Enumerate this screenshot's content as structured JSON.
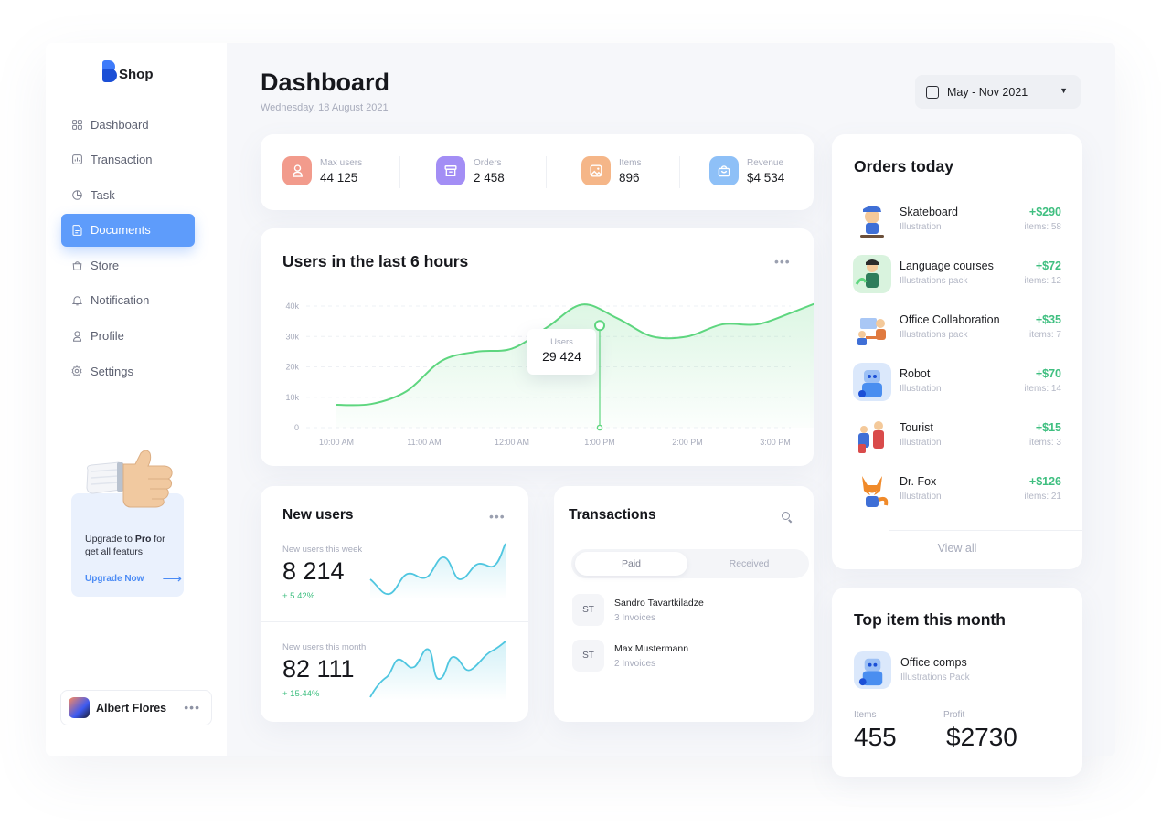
{
  "brand": {
    "name": "Shop",
    "colors": {
      "primary": "#5e9cfb",
      "positive": "#3fbf80",
      "chart_line": "#5ed67f",
      "sparkline": "#4fc6e0"
    }
  },
  "sidebar": {
    "items": [
      {
        "label": "Dashboard",
        "icon": "grid-icon",
        "active": false
      },
      {
        "label": "Transaction",
        "icon": "chart-icon",
        "active": false
      },
      {
        "label": "Task",
        "icon": "pie-icon",
        "active": false
      },
      {
        "label": "Documents",
        "icon": "document-icon",
        "active": true
      },
      {
        "label": "Store",
        "icon": "bag-icon",
        "active": false
      },
      {
        "label": "Notification",
        "icon": "bell-icon",
        "active": false
      },
      {
        "label": "Profile",
        "icon": "user-icon",
        "active": false
      },
      {
        "label": "Settings",
        "icon": "gear-icon",
        "active": false
      }
    ],
    "upgrade": {
      "text_prefix": "Upgrade to ",
      "text_bold": "Pro",
      "text_suffix": " for get all featurs",
      "link": "Upgrade Now"
    },
    "user": {
      "name": "Albert Flores"
    }
  },
  "header": {
    "title": "Dashboard",
    "date": "Wednesday, 18 August 2021",
    "date_filter": "May - Nov 2021"
  },
  "stats": [
    {
      "label": "Max users",
      "value": "44 125",
      "icon": "user-icon",
      "color": "#f29b8c"
    },
    {
      "label": "Orders",
      "value": "2 458",
      "icon": "archive-icon",
      "color": "#a38ef5"
    },
    {
      "label": "Items",
      "value": "896",
      "icon": "image-icon",
      "color": "#f5b688"
    },
    {
      "label": "Revenue",
      "value": "$4 534",
      "icon": "bag-icon",
      "color": "#8ec0f7"
    }
  ],
  "users_chart": {
    "title": "Users in the last 6 hours",
    "tooltip": {
      "label": "Users",
      "value": "29 424"
    }
  },
  "chart_data": {
    "type": "area",
    "title": "Users in the last 6 hours",
    "x": [
      "10:00 AM",
      "11:00 AM",
      "12:00 AM",
      "1:00 PM",
      "2:00 PM",
      "3:00 PM"
    ],
    "y_ticks": [
      "0",
      "10k",
      "20k",
      "30k",
      "40k"
    ],
    "ylim": [
      0,
      40000
    ],
    "points": [
      {
        "x": 0.0,
        "y": 7500
      },
      {
        "x": 0.4,
        "y": 7800
      },
      {
        "x": 0.8,
        "y": 12000
      },
      {
        "x": 1.2,
        "y": 22000
      },
      {
        "x": 1.6,
        "y": 25000
      },
      {
        "x": 2.0,
        "y": 26000
      },
      {
        "x": 2.4,
        "y": 33000
      },
      {
        "x": 2.8,
        "y": 40500
      },
      {
        "x": 3.2,
        "y": 36000
      },
      {
        "x": 3.6,
        "y": 30000
      },
      {
        "x": 4.0,
        "y": 30000
      },
      {
        "x": 4.4,
        "y": 34000
      },
      {
        "x": 4.8,
        "y": 34000
      },
      {
        "x": 5.2,
        "y": 38000
      },
      {
        "x": 5.6,
        "y": 42500
      }
    ],
    "highlight": {
      "x": 3.0,
      "y": 33600,
      "label": "Users",
      "value": "29 424"
    },
    "grid": true
  },
  "new_users": {
    "title": "New users",
    "week": {
      "label": "New users this week",
      "value": "8 214",
      "change": "+ 5.42%"
    },
    "month": {
      "label": "New users this month",
      "value": "82 111",
      "change": "+ 15.44%"
    }
  },
  "transactions": {
    "title": "Transactions",
    "tabs": [
      "Paid",
      "Received"
    ],
    "rows": [
      {
        "initials": "ST",
        "name": "Sandro Tavartkiladze",
        "sub": "3 Invoices"
      },
      {
        "initials": "ST",
        "name": "Max Mustermann",
        "sub": "2 Invoices"
      }
    ]
  },
  "orders_today": {
    "title": "Orders today",
    "items": [
      {
        "name": "Skateboard",
        "sub": "Illustration",
        "price": "+$290",
        "items": "items: 58",
        "colors": [
          "#ffe4cf",
          "#3f6fd6"
        ]
      },
      {
        "name": "Language courses",
        "sub": "Illustrations pack",
        "price": "+$72",
        "items": "items: 12",
        "colors": [
          "#d9f3de",
          "#2e7d5b"
        ]
      },
      {
        "name": "Office Collaboration",
        "sub": "Illustrations pack",
        "price": "+$35",
        "items": "items: 7",
        "colors": [
          "#fde9da",
          "#e07a3f"
        ]
      },
      {
        "name": "Robot",
        "sub": "Illustration",
        "price": "+$70",
        "items": "items: 14",
        "colors": [
          "#dbe8fb",
          "#4a8ef0"
        ]
      },
      {
        "name": "Tourist",
        "sub": "Illustration",
        "price": "+$15",
        "items": "items: 3",
        "colors": [
          "#fde3e3",
          "#d94b4b"
        ]
      },
      {
        "name": "Dr. Fox",
        "sub": "Illustration",
        "price": "+$126",
        "items": "items: 21",
        "colors": [
          "#fff1dc",
          "#f08a2a"
        ]
      }
    ],
    "view_all": "View all"
  },
  "top_item": {
    "title": "Top item this month",
    "name": "Office comps",
    "sub": "Illustrations Pack",
    "items_label": "Items",
    "items_value": "455",
    "profit_label": "Profit",
    "profit_value": "$2730"
  }
}
